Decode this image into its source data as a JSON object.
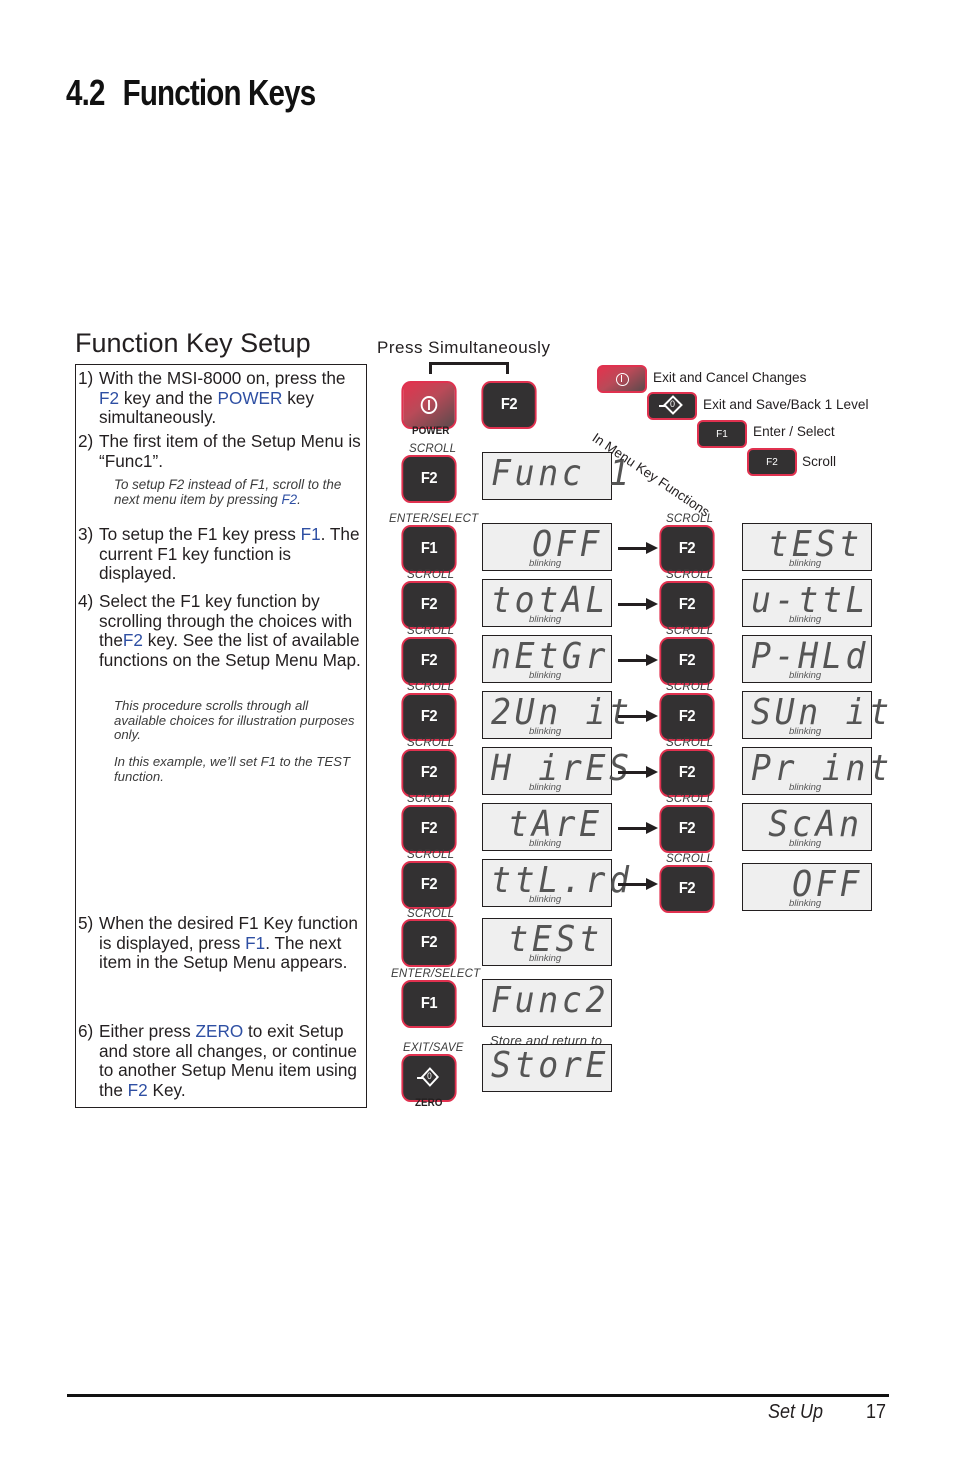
{
  "heading": {
    "number": "4.2",
    "title": "Function Keys"
  },
  "section_title": "Function Key Setup",
  "press_simultaneously": "Press Simultaneously",
  "steps": [
    {
      "num": "1)",
      "parts": [
        "With the MSI-8000 on, press the ",
        "F2",
        " key and the ",
        "POWER",
        " key simultaneously."
      ]
    },
    {
      "num": "2)",
      "text": "The first item of the Setup Menu is “Func1”."
    },
    {
      "num": "3)",
      "parts": [
        "To setup the F1 key press ",
        "F1",
        ". The current F1 key function is displayed."
      ]
    },
    {
      "num": "4)",
      "parts": [
        "Select the F1 key function by scrolling through the choices with the",
        "F2",
        " key. See the list of available functions on the Setup Menu Map."
      ]
    },
    {
      "num": "5)",
      "parts": [
        "When the desired F1 Key function is displayed, press ",
        "F1",
        ". The next item in the Setup Menu appears."
      ]
    },
    {
      "num": "6)",
      "parts": [
        "Either press ",
        "ZERO",
        " to exit Setup and store all changes, or continue to another Setup Menu item using the ",
        "F2",
        " Key."
      ]
    }
  ],
  "notes": {
    "f2_setup": [
      "To setup F2 instead of F1, scroll to the next menu item by pressing ",
      "F2",
      "."
    ],
    "illustration": "This procedure scrolls through all available choices for illustration purposes only.",
    "example": "In this example, we’ll set F1 to the TEST function."
  },
  "keys": {
    "power_caption": "POWER",
    "zero_caption": "ZERO",
    "f1": "F1",
    "f2": "F2",
    "scroll": "SCROLL",
    "enter_select": "ENTER/SELECT",
    "exit_save": "EXIT/SAVE"
  },
  "legend": {
    "title": "In Menu Key Functions",
    "items": [
      {
        "key": "power-key",
        "label": "Exit and Cancel Changes"
      },
      {
        "key": "zero-key",
        "label": "Exit and Save/Back 1 Level"
      },
      {
        "key": "F1",
        "label": "Enter / Select"
      },
      {
        "key": "F2",
        "label": "Scroll"
      }
    ]
  },
  "display_func1": "Func 1",
  "left_column": [
    {
      "caption": "ENTER/SELECT",
      "key": "F1",
      "display": "OFF",
      "blinking": "blinking",
      "align": "right"
    },
    {
      "caption": "SCROLL",
      "key": "F2",
      "display": "totAL",
      "blinking": "blinking",
      "align": "left"
    },
    {
      "caption": "SCROLL",
      "key": "F2",
      "display": "nEtGr",
      "blinking": "blinking",
      "align": "left"
    },
    {
      "caption": "SCROLL",
      "key": "F2",
      "display": "2Un it",
      "blinking": "blinking",
      "align": "left"
    },
    {
      "caption": "SCROLL",
      "key": "F2",
      "display": "H irES",
      "blinking": "blinking",
      "align": "left"
    },
    {
      "caption": "SCROLL",
      "key": "F2",
      "display": "tArE",
      "blinking": "blinking",
      "align": "right"
    },
    {
      "caption": "SCROLL",
      "key": "F2",
      "display": "ttL.rd",
      "blinking": "blinking",
      "align": "left"
    }
  ],
  "right_column": [
    {
      "caption": "SCROLL",
      "key": "F2",
      "display": "tESt",
      "blinking": "blinking",
      "align": "right"
    },
    {
      "caption": "SCROLL",
      "key": "F2",
      "display": "u-ttL",
      "blinking": "blinking",
      "align": "left"
    },
    {
      "caption": "SCROLL",
      "key": "F2",
      "display": "P-HLd",
      "blinking": "blinking",
      "align": "left"
    },
    {
      "caption": "SCROLL",
      "key": "F2",
      "display": "SUn it",
      "blinking": "blinking",
      "align": "left"
    },
    {
      "caption": "SCROLL",
      "key": "F2",
      "display": "Pr int",
      "blinking": "blinking",
      "align": "left"
    },
    {
      "caption": "SCROLL",
      "key": "F2",
      "display": "ScAn",
      "blinking": "blinking",
      "align": "right"
    },
    {
      "caption": "SCROLL",
      "key": "F2",
      "display": "OFF",
      "blinking": "blinking",
      "align": "right"
    }
  ],
  "final_steps": [
    {
      "caption": "SCROLL",
      "key": "F2",
      "display": "tESt",
      "blinking": "blinking"
    },
    {
      "caption": "ENTER/SELECT",
      "key": "F1",
      "display": "Func2"
    },
    {
      "caption": "EXIT/SAVE",
      "key": "zero",
      "display": "StorE",
      "above": "Store and return to"
    }
  ],
  "footer": {
    "section": "Set Up",
    "page": "17"
  }
}
